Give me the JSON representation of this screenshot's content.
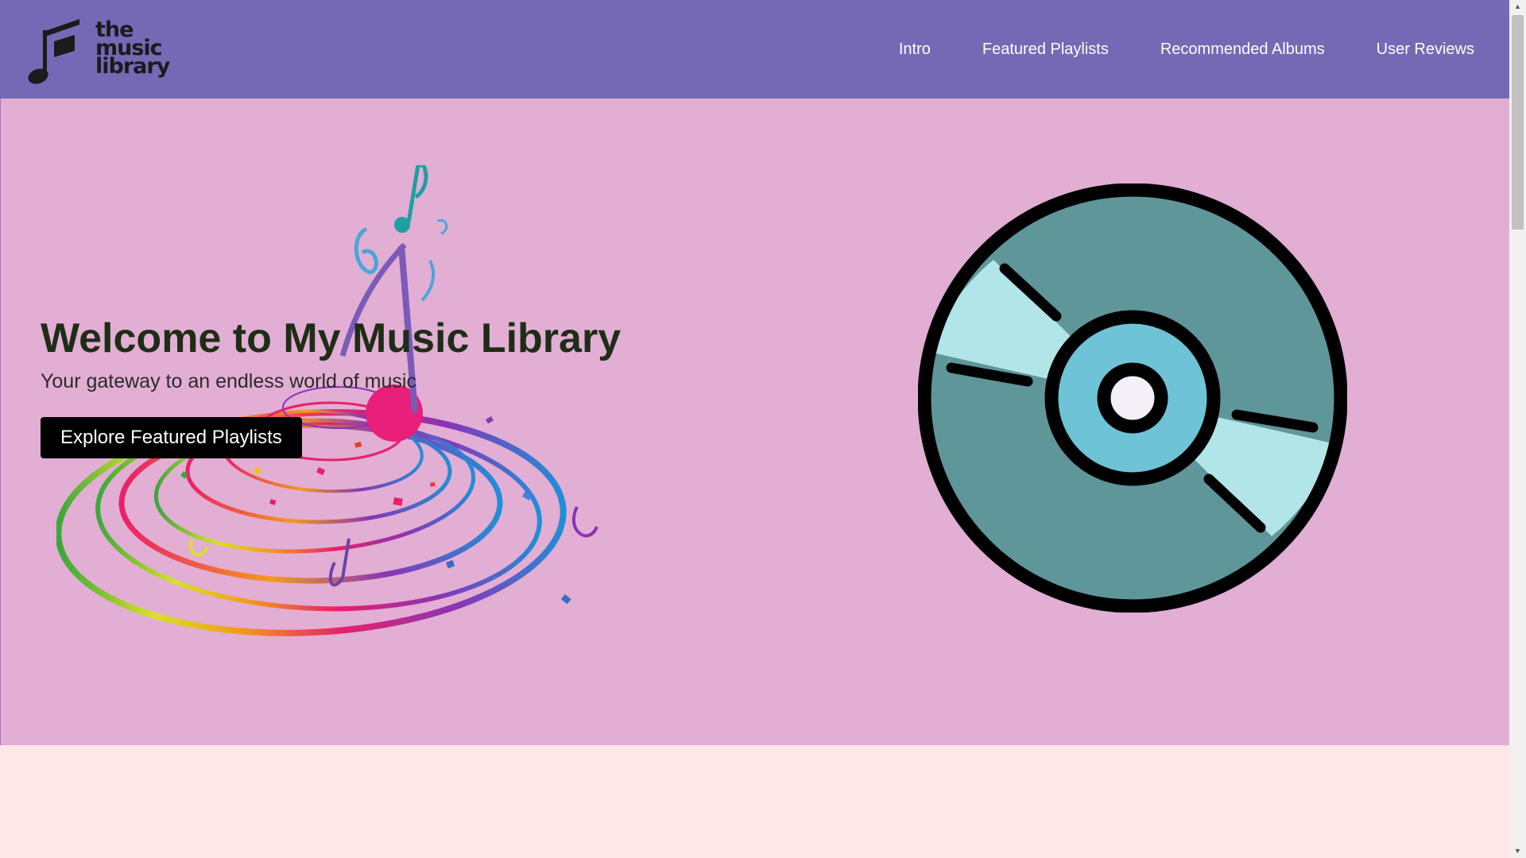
{
  "navbar": {
    "logo": {
      "line1": "the",
      "line2": "music",
      "line3": "library",
      "mark": "music-note-icon"
    },
    "links": [
      {
        "label": "Intro"
      },
      {
        "label": "Featured Playlists"
      },
      {
        "label": "Recommended Albums"
      },
      {
        "label": "User Reviews"
      }
    ]
  },
  "hero": {
    "title": "Welcome to My Music Library",
    "subtitle": "Your gateway to an endless world of music",
    "cta_label": "Explore Featured Playlists",
    "illustration_left": "music-swirl-illustration",
    "illustration_right": "cd-disc-icon"
  },
  "colors": {
    "navbar": "#7569b6",
    "hero_background": "#e2aed4",
    "page_background": "#ffe6e8",
    "button": "#000000",
    "disc_outer": "#5f969a",
    "disc_highlight": "#b2e5e8",
    "disc_center": "#6ec4d6"
  }
}
